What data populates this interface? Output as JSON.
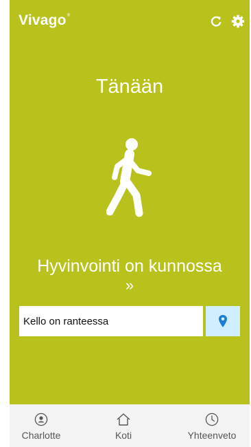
{
  "app": {
    "brand": "Vivago",
    "brand_mark": "®"
  },
  "header": {
    "icons": [
      "refresh-icon",
      "gear-icon"
    ]
  },
  "main": {
    "title": "Tänään",
    "activity_icon": "walking-person-icon",
    "status_text": "Hyvinvointi on kunnossa",
    "status_chevron": "»",
    "watch_status": "Kello on ranteessa",
    "location_icon": "location-pin-icon"
  },
  "nav": {
    "items": [
      {
        "label": "Charlotte",
        "icon": "user-circle-icon"
      },
      {
        "label": "Koti",
        "icon": "home-icon"
      },
      {
        "label": "Yhteenveto",
        "icon": "clock-icon"
      }
    ]
  },
  "colors": {
    "main_bg": "#b9c21d",
    "nav_bg": "#f3f3f3",
    "location_btn_bg": "#cfeeff",
    "pin_color": "#1a7fd1"
  }
}
